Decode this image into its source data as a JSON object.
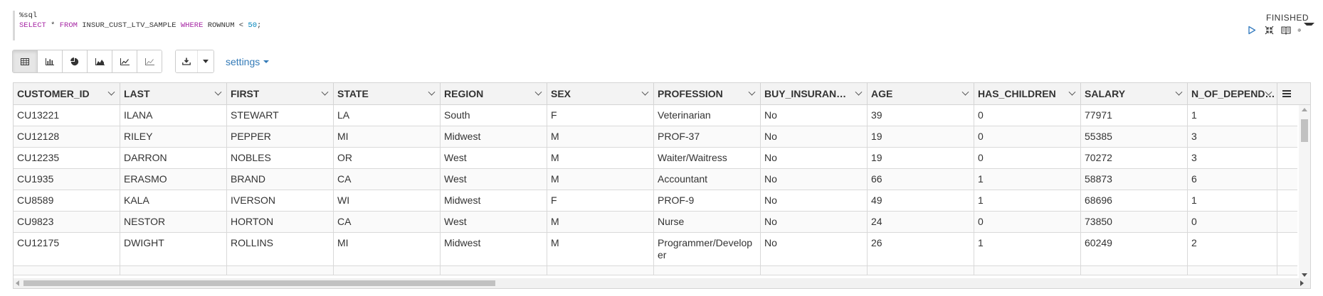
{
  "editor": {
    "line1": "%sql",
    "kw_select": "SELECT",
    "star": " * ",
    "kw_from": "FROM",
    "table": " INSUR_CUST_LTV_SAMPLE ",
    "kw_where": "WHERE",
    "col": " ROWNUM < ",
    "num": "50",
    "semi": ";"
  },
  "status": "FINISHED",
  "paragraph_tools": [
    "run-icon",
    "collapse-icon",
    "book-icon",
    "gear-icon"
  ],
  "toolbar": {
    "viz_buttons": [
      "table-icon",
      "bar-chart-icon",
      "pie-chart-icon",
      "area-chart-icon",
      "line-chart-icon",
      "scatter-chart-icon"
    ],
    "download_icon": "download-icon",
    "settings_label": "settings"
  },
  "colors": {
    "link": "#337ab7",
    "keyword": "#a626a4",
    "number": "#0184bc"
  },
  "table": {
    "columns": [
      "CUSTOMER_ID",
      "LAST",
      "FIRST",
      "STATE",
      "REGION",
      "SEX",
      "PROFESSION",
      "BUY_INSURANCE",
      "AGE",
      "HAS_CHILDREN",
      "SALARY",
      "N_OF_DEPENDENTS"
    ],
    "rows": [
      [
        "CU13221",
        "ILANA",
        "STEWART",
        "LA",
        "South",
        "F",
        "Veterinarian",
        "No",
        "39",
        "0",
        "77971",
        "1"
      ],
      [
        "CU12128",
        "RILEY",
        "PEPPER",
        "MI",
        "Midwest",
        "M",
        "PROF-37",
        "No",
        "19",
        "0",
        "55385",
        "3"
      ],
      [
        "CU12235",
        "DARRON",
        "NOBLES",
        "OR",
        "West",
        "M",
        "Waiter/Waitress",
        "No",
        "19",
        "0",
        "70272",
        "3"
      ],
      [
        "CU1935",
        "ERASMO",
        "BRAND",
        "CA",
        "West",
        "M",
        "Accountant",
        "No",
        "66",
        "1",
        "58873",
        "6"
      ],
      [
        "CU8589",
        "KALA",
        "IVERSON",
        "WI",
        "Midwest",
        "F",
        "PROF-9",
        "No",
        "49",
        "1",
        "68696",
        "1"
      ],
      [
        "CU9823",
        "NESTOR",
        "HORTON",
        "CA",
        "West",
        "M",
        "Nurse",
        "No",
        "24",
        "0",
        "73850",
        "0"
      ],
      [
        "CU12175",
        "DWIGHT",
        "ROLLINS",
        "MI",
        "Midwest",
        "M",
        "Programmer/Developer",
        "No",
        "26",
        "1",
        "60249",
        "2"
      ],
      [
        "",
        "",
        "",
        "",
        "",
        "",
        "",
        "",
        "",
        "",
        "",
        ""
      ]
    ]
  }
}
